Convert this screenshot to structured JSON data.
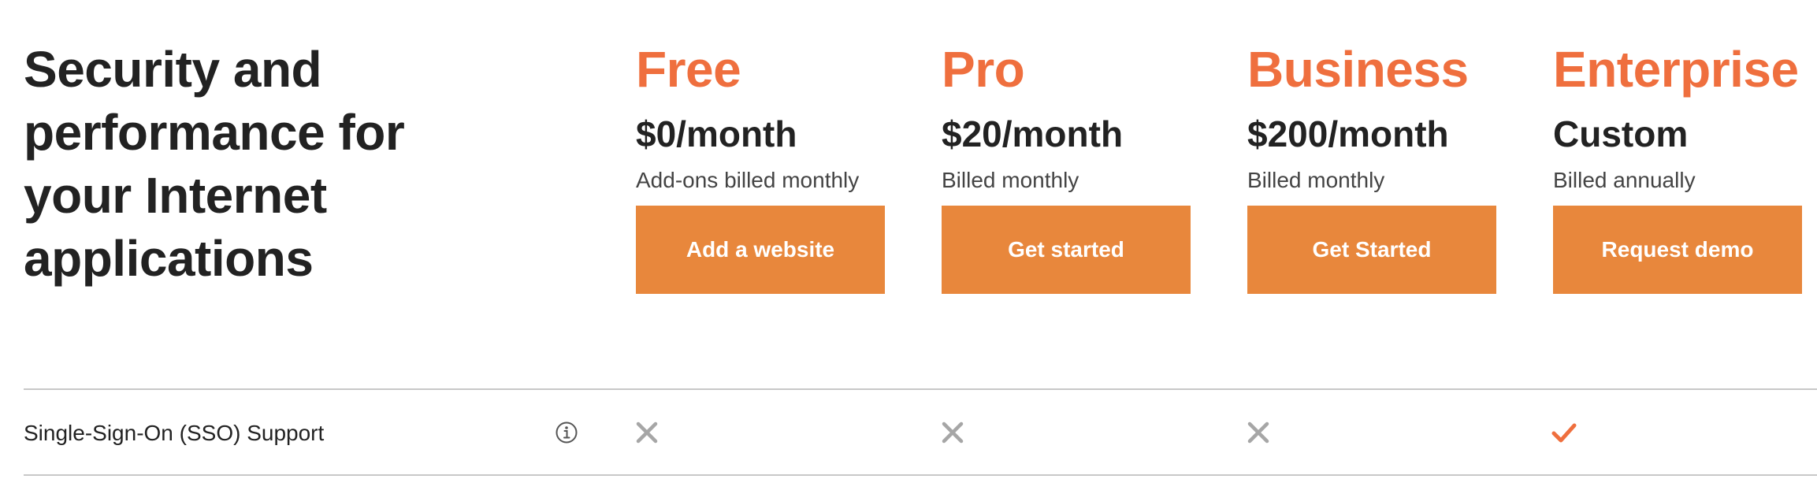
{
  "headline": "Security and performance for your Internet applications",
  "plans": [
    {
      "name": "Free",
      "price": "$0/month",
      "billing": "Add-ons billed monthly",
      "button_label": "Add a website"
    },
    {
      "name": "Pro",
      "price": "$20/month",
      "billing": "Billed monthly",
      "button_label": "Get started"
    },
    {
      "name": "Business",
      "price": "$200/month",
      "billing": "Billed monthly",
      "button_label": "Get Started"
    },
    {
      "name": "Enterprise",
      "price": "Custom",
      "billing": "Billed annually",
      "button_label": "Request demo"
    }
  ],
  "feature_rows": [
    {
      "label": "Single-Sign-On (SSO) Support",
      "info_icon": "info-icon",
      "availability": [
        false,
        false,
        false,
        true
      ]
    }
  ],
  "colors": {
    "plan_name": "#ef6f3e",
    "button_bg": "#e8873c",
    "button_text": "#ffffff",
    "check": "#ef6f3e",
    "cross": "#a6a6a6",
    "divider": "#c8c8c8"
  }
}
